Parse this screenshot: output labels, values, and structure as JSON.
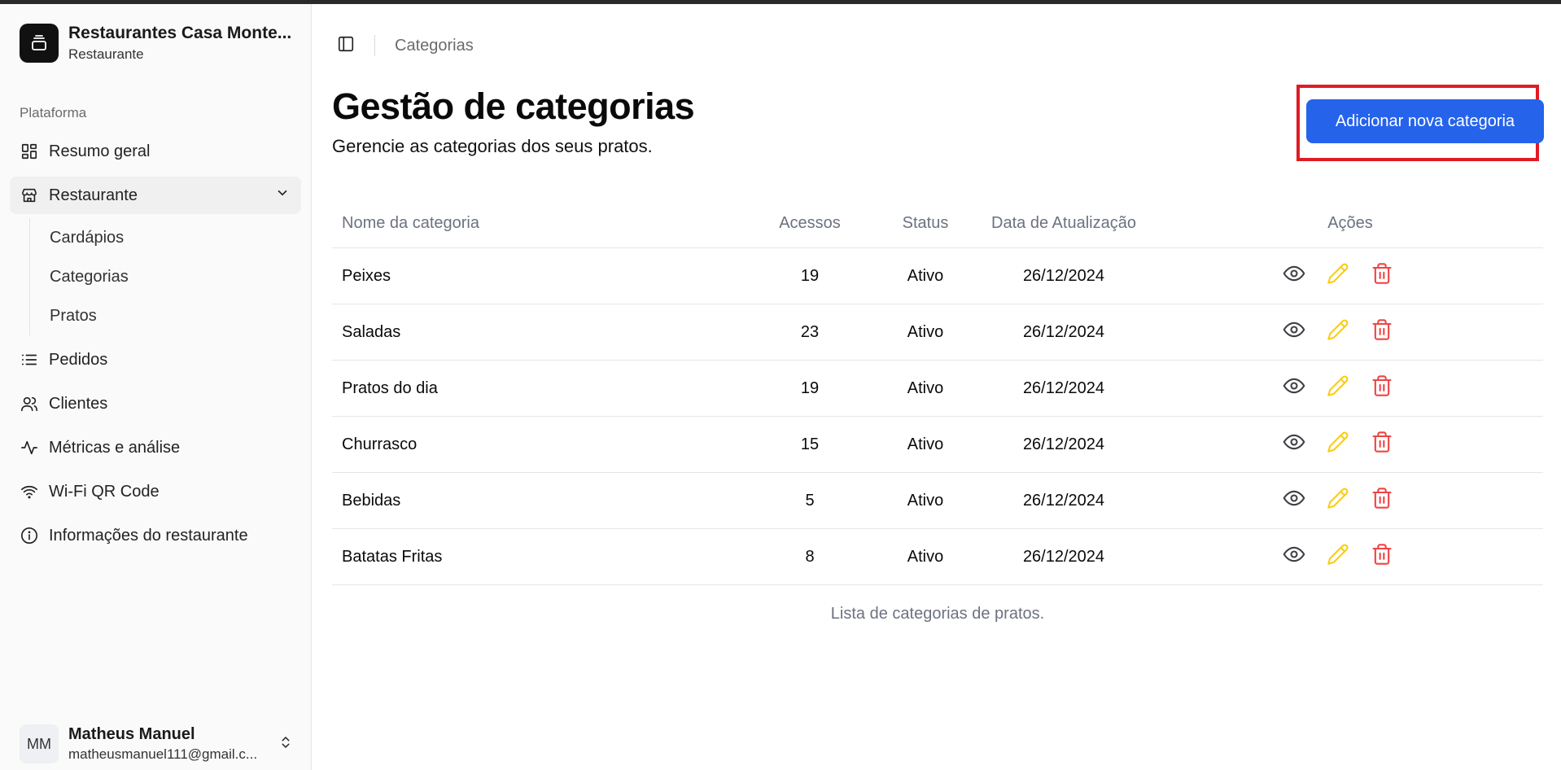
{
  "sidebar": {
    "brand_name": "Restaurantes Casa Monte...",
    "brand_sub": "Restaurante",
    "section_label": "Plataforma",
    "items": [
      {
        "label": "Resumo geral",
        "icon": "dashboard-icon"
      },
      {
        "label": "Restaurante",
        "icon": "store-icon"
      },
      {
        "label": "Pedidos",
        "icon": "list-icon"
      },
      {
        "label": "Clientes",
        "icon": "users-icon"
      },
      {
        "label": "Métricas e análise",
        "icon": "activity-icon"
      },
      {
        "label": "Wi-Fi QR Code",
        "icon": "wifi-icon"
      },
      {
        "label": "Informações do restaurante",
        "icon": "info-icon"
      }
    ],
    "sub_items": [
      {
        "label": "Cardápios"
      },
      {
        "label": "Categorias"
      },
      {
        "label": "Pratos"
      }
    ],
    "user": {
      "initials": "MM",
      "name": "Matheus Manuel",
      "email": "matheusmanuel111@gmail.c..."
    }
  },
  "header": {
    "breadcrumb": "Categorias"
  },
  "main": {
    "title": "Gestão de categorias",
    "subtitle": "Gerencie as categorias dos seus pratos.",
    "add_button": "Adicionar nova categoria",
    "caption": "Lista de categorias de pratos."
  },
  "table": {
    "headers": {
      "name": "Nome da categoria",
      "accesses": "Acessos",
      "status": "Status",
      "date": "Data de Atualização",
      "actions": "Ações"
    },
    "rows": [
      {
        "name": "Peixes",
        "accesses": "19",
        "status": "Ativo",
        "date": "26/12/2024"
      },
      {
        "name": "Saladas",
        "accesses": "23",
        "status": "Ativo",
        "date": "26/12/2024"
      },
      {
        "name": "Pratos do dia",
        "accesses": "19",
        "status": "Ativo",
        "date": "26/12/2024"
      },
      {
        "name": "Churrasco",
        "accesses": "15",
        "status": "Ativo",
        "date": "26/12/2024"
      },
      {
        "name": "Bebidas",
        "accesses": "5",
        "status": "Ativo",
        "date": "26/12/2024"
      },
      {
        "name": "Batatas Fritas",
        "accesses": "8",
        "status": "Ativo",
        "date": "26/12/2024"
      }
    ]
  },
  "colors": {
    "accent": "#2563eb",
    "highlight": "#e01b24",
    "edit": "#facc15",
    "delete": "#ef4444"
  }
}
